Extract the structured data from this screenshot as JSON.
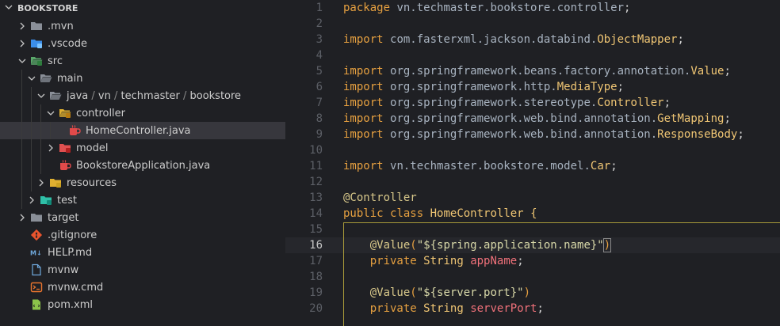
{
  "explorer": {
    "section_title": "BOOKSTORE",
    "items": [
      {
        "label": ".mvn",
        "depth": 1,
        "twisty": "right",
        "icon": "folder-icon"
      },
      {
        "label": ".vscode",
        "depth": 1,
        "twisty": "right",
        "icon": "vscode-folder-icon"
      },
      {
        "label": "src",
        "depth": 1,
        "twisty": "down",
        "icon": "src-folder-icon"
      },
      {
        "label": "main",
        "depth": 2,
        "twisty": "down",
        "icon": "folder-open-icon"
      },
      {
        "label": "java / vn / techmaster / bookstore",
        "depth": 3,
        "twisty": "down",
        "icon": "folder-open-icon"
      },
      {
        "label": "controller",
        "depth": 4,
        "twisty": "down",
        "icon": "controller-folder-icon"
      },
      {
        "label": "HomeController.java",
        "depth": 5,
        "twisty": "none",
        "icon": "java-file-icon",
        "selected": true
      },
      {
        "label": "model",
        "depth": 4,
        "twisty": "right",
        "icon": "model-folder-icon"
      },
      {
        "label": "BookstoreApplication.java",
        "depth": 4,
        "twisty": "none",
        "icon": "java-file-icon"
      },
      {
        "label": "resources",
        "depth": 3,
        "twisty": "right",
        "icon": "resources-folder-icon"
      },
      {
        "label": "test",
        "depth": 2,
        "twisty": "right",
        "icon": "test-folder-icon"
      },
      {
        "label": "target",
        "depth": 1,
        "twisty": "right",
        "icon": "folder-icon"
      },
      {
        "label": ".gitignore",
        "depth": 1,
        "twisty": "none",
        "icon": "git-file-icon"
      },
      {
        "label": "HELP.md",
        "depth": 1,
        "twisty": "none",
        "icon": "markdown-file-icon"
      },
      {
        "label": "mvnw",
        "depth": 1,
        "twisty": "none",
        "icon": "file-icon"
      },
      {
        "label": "mvnw.cmd",
        "depth": 1,
        "twisty": "none",
        "icon": "cmd-file-icon"
      },
      {
        "label": "pom.xml",
        "depth": 1,
        "twisty": "none",
        "icon": "xml-file-icon"
      }
    ]
  },
  "editor": {
    "current_line": 16,
    "lines": [
      {
        "n": "1",
        "tokens": [
          [
            "kw",
            "package"
          ],
          [
            "plain",
            " "
          ],
          [
            "pkg",
            "vn.techmaster.bookstore.controller"
          ],
          [
            "plain",
            ";"
          ]
        ]
      },
      {
        "n": "2",
        "tokens": []
      },
      {
        "n": "3",
        "tokens": [
          [
            "kw",
            "import"
          ],
          [
            "plain",
            " "
          ],
          [
            "pkg",
            "com.fasterxml.jackson.databind."
          ],
          [
            "cls",
            "ObjectMapper"
          ],
          [
            "plain",
            ";"
          ]
        ]
      },
      {
        "n": "4",
        "tokens": []
      },
      {
        "n": "5",
        "tokens": [
          [
            "kw",
            "import"
          ],
          [
            "plain",
            " "
          ],
          [
            "pkg",
            "org.springframework.beans.factory.annotation."
          ],
          [
            "cls",
            "Value"
          ],
          [
            "plain",
            ";"
          ]
        ]
      },
      {
        "n": "6",
        "tokens": [
          [
            "kw",
            "import"
          ],
          [
            "plain",
            " "
          ],
          [
            "pkg",
            "org.springframework.http."
          ],
          [
            "cls",
            "MediaType"
          ],
          [
            "plain",
            ";"
          ]
        ]
      },
      {
        "n": "7",
        "tokens": [
          [
            "kw",
            "import"
          ],
          [
            "plain",
            " "
          ],
          [
            "pkg",
            "org.springframework.stereotype."
          ],
          [
            "cls",
            "Controller"
          ],
          [
            "plain",
            ";"
          ]
        ]
      },
      {
        "n": "8",
        "tokens": [
          [
            "kw",
            "import"
          ],
          [
            "plain",
            " "
          ],
          [
            "pkg",
            "org.springframework.web.bind.annotation."
          ],
          [
            "cls",
            "GetMapping"
          ],
          [
            "plain",
            ";"
          ]
        ]
      },
      {
        "n": "9",
        "tokens": [
          [
            "kw",
            "import"
          ],
          [
            "plain",
            " "
          ],
          [
            "pkg",
            "org.springframework.web.bind.annotation."
          ],
          [
            "cls",
            "ResponseBody"
          ],
          [
            "plain",
            ";"
          ]
        ]
      },
      {
        "n": "10",
        "tokens": []
      },
      {
        "n": "11",
        "tokens": [
          [
            "kw",
            "import"
          ],
          [
            "plain",
            " "
          ],
          [
            "pkg",
            "vn.techmaster.bookstore.model."
          ],
          [
            "cls",
            "Car"
          ],
          [
            "plain",
            ";"
          ]
        ]
      },
      {
        "n": "12",
        "tokens": []
      },
      {
        "n": "13",
        "tokens": [
          [
            "ann",
            "@Controller"
          ]
        ]
      },
      {
        "n": "14",
        "tokens": [
          [
            "kw",
            "public"
          ],
          [
            "plain",
            " "
          ],
          [
            "kw",
            "class"
          ],
          [
            "plain",
            " "
          ],
          [
            "cls",
            "HomeController"
          ],
          [
            "plain",
            " "
          ],
          [
            "brace",
            "{"
          ]
        ]
      },
      {
        "n": "15",
        "tokens": []
      },
      {
        "n": "16",
        "tokens": [
          [
            "plain",
            "    "
          ],
          [
            "ann",
            "@Value"
          ],
          [
            "paren",
            "("
          ],
          [
            "str",
            "\"${spring.application.name}\""
          ],
          [
            "paren",
            "cursor:)"
          ]
        ]
      },
      {
        "n": "17",
        "tokens": [
          [
            "plain",
            "    "
          ],
          [
            "kw",
            "private"
          ],
          [
            "plain",
            " "
          ],
          [
            "cls",
            "String"
          ],
          [
            "plain",
            " "
          ],
          [
            "id",
            "appName"
          ],
          [
            "plain",
            ";"
          ]
        ]
      },
      {
        "n": "18",
        "tokens": []
      },
      {
        "n": "19",
        "tokens": [
          [
            "plain",
            "    "
          ],
          [
            "ann",
            "@Value"
          ],
          [
            "paren",
            "("
          ],
          [
            "str",
            "\"${server.port}\""
          ],
          [
            "paren",
            ")"
          ]
        ]
      },
      {
        "n": "20",
        "tokens": [
          [
            "plain",
            "    "
          ],
          [
            "kw",
            "private"
          ],
          [
            "plain",
            " "
          ],
          [
            "cls",
            "String"
          ],
          [
            "plain",
            " "
          ],
          [
            "id",
            "serverPort"
          ],
          [
            "plain",
            ";"
          ]
        ]
      }
    ]
  },
  "colors": {
    "background": "#1f2024",
    "keyword": "#e6a040",
    "type": "#f0c674",
    "identifier": "#f0717a",
    "selected_row": "#37373d"
  }
}
